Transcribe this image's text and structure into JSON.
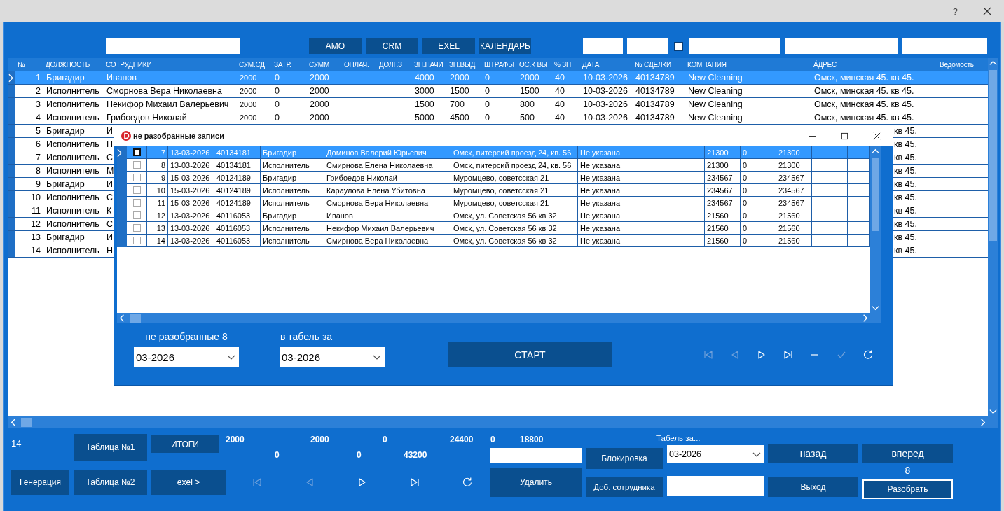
{
  "window": {
    "help": "?"
  },
  "toolbar": {
    "buttons": [
      "AMO",
      "CRM",
      "EXEL",
      "КАЛЕНДАРЬ"
    ],
    "filter_checkbox": {
      "checked": false
    }
  },
  "main_table": {
    "columns": [
      "№",
      "ДОЛЖНОСТЬ",
      "СОТРУДНИКИ",
      "СУМ.СД",
      "ЗАТР.",
      "СУММ",
      "ОПЛАЧ.",
      "ДОЛГ.З",
      "ЗП.НАЧИ",
      "ЗП.ВЫД.",
      "ШТРАФЫ",
      "ОС.К ВЫ",
      "% ЗП",
      "ДАТА",
      "№ СДЕЛКИ",
      "КОМПАНИЯ",
      "А́ДРЕС",
      "Ведомость"
    ],
    "rows": [
      {
        "kind": "full",
        "selected": true,
        "num": "1",
        "role": "Бригадир",
        "name": "Иванов",
        "sum_sd": "2000",
        "expenses": "0",
        "sum": "2000",
        "zp_accrued": "4000",
        "zp_paid": "2000",
        "fines": "0",
        "balance": "2000",
        "percent": "40",
        "date": "10-03-2026",
        "deal": "40134789",
        "company": "New Cleaning",
        "address": "Омск, минская 45. кв 45."
      },
      {
        "kind": "full",
        "selected": false,
        "num": "2",
        "role": "Исполнитель",
        "name": "Сморнова Вера Николаевна",
        "sum_sd": "2000",
        "expenses": "0",
        "sum": "2000",
        "zp_accrued": "3000",
        "zp_paid": "1500",
        "fines": "0",
        "balance": "1500",
        "percent": "40",
        "date": "10-03-2026",
        "deal": "40134789",
        "company": "New Cleaning",
        "address": "Омск, минская 45. кв 45."
      },
      {
        "kind": "full",
        "selected": false,
        "num": "3",
        "role": "Исполнитель",
        "name": "Некифор Михаил Валерьевич",
        "sum_sd": "2000",
        "expenses": "0",
        "sum": "2000",
        "zp_accrued": "1500",
        "zp_paid": "700",
        "fines": "0",
        "balance": "800",
        "percent": "40",
        "date": "10-03-2026",
        "deal": "40134789",
        "company": "New Cleaning",
        "address": "Омск, минская 45. кв 45."
      },
      {
        "kind": "full",
        "selected": false,
        "num": "4",
        "role": "Исполнитель",
        "name": "Грибоедов Николай",
        "sum_sd": "2000",
        "expenses": "0",
        "sum": "2000",
        "zp_accrued": "5000",
        "zp_paid": "4500",
        "fines": "0",
        "balance": "500",
        "percent": "40",
        "date": "10-03-2026",
        "deal": "40134789",
        "company": "New Cleaning",
        "address": "Омск, минская 45. кв 45."
      },
      {
        "kind": "partial",
        "selected": false,
        "num": "5",
        "role": "Бригадир",
        "name": "И",
        "address": "кв 45."
      },
      {
        "kind": "partial",
        "selected": false,
        "num": "6",
        "role": "Исполнитель",
        "name": "Н",
        "address": "кв 45."
      },
      {
        "kind": "partial",
        "selected": false,
        "num": "7",
        "role": "Исполнитель",
        "name": "С",
        "address": "кв 45."
      },
      {
        "kind": "partial",
        "selected": false,
        "num": "8",
        "role": "Исполнитель",
        "name": "М",
        "address": "кв 45."
      },
      {
        "kind": "partial",
        "selected": false,
        "num": "9",
        "role": "Бригадир",
        "name": "И",
        "address": "кв 45."
      },
      {
        "kind": "partial",
        "selected": false,
        "num": "10",
        "role": "Исполнитель",
        "name": "С",
        "address": "кв 45."
      },
      {
        "kind": "partial",
        "selected": false,
        "num": "11",
        "role": "Исполнитель",
        "name": "К",
        "address": "кв 45."
      },
      {
        "kind": "partial",
        "selected": false,
        "num": "12",
        "role": "Исполнитель",
        "name": "С",
        "address": "кв 45."
      },
      {
        "kind": "partial",
        "selected": false,
        "num": "13",
        "role": "Бригадир",
        "name": "И",
        "address": "кв 45."
      },
      {
        "kind": "partial",
        "selected": false,
        "num": "14",
        "role": "Исполнитель",
        "name": "Н",
        "address": "кв 45."
      }
    ]
  },
  "dialog": {
    "title": "не разобранные записи",
    "rows": [
      {
        "selected": true,
        "checked": false,
        "num": "7",
        "date": "13-03-2026",
        "deal": "40134181",
        "role": "Бригадир",
        "name": "Доминов Валерий Юрьевич",
        "address": "Омск, питерсий проезд 24, кв. 56",
        "company": "Не указана",
        "c1": "21300",
        "c2": "0",
        "c3": "21300"
      },
      {
        "selected": false,
        "checked": false,
        "num": "8",
        "date": "13-03-2026",
        "deal": "40134181",
        "role": "Исполнитель",
        "name": "Смирнова Елена Николаевна",
        "address": "Омск, питерсий проезд 24, кв. 56",
        "company": "Не указана",
        "c1": "21300",
        "c2": "0",
        "c3": "21300"
      },
      {
        "selected": false,
        "checked": false,
        "num": "9",
        "date": "15-03-2026",
        "deal": "40124189",
        "role": "Бригадир",
        "name": "Грибоедов Николай",
        "address": "Муромцево, советсская 21",
        "company": "Не указана",
        "c1": "234567",
        "c2": "0",
        "c3": "234567"
      },
      {
        "selected": false,
        "checked": false,
        "num": "10",
        "date": "15-03-2026",
        "deal": "40124189",
        "role": "Исполнитель",
        "name": "Караулова Елена Убитовна",
        "address": "Муромцево, советсская 21",
        "company": "Не указана",
        "c1": "234567",
        "c2": "0",
        "c3": "234567"
      },
      {
        "selected": false,
        "checked": false,
        "num": "11",
        "date": "15-03-2026",
        "deal": "40124189",
        "role": "Исполнитель",
        "name": "Сморнова Вера Николаевна",
        "address": "Муромцево, советсская 21",
        "company": "Не указана",
        "c1": "234567",
        "c2": "0",
        "c3": "234567"
      },
      {
        "selected": false,
        "checked": false,
        "num": "12",
        "date": "13-03-2026",
        "deal": "40116053",
        "role": "Бригадир",
        "name": "Иванов",
        "address": "Омск, ул. Советская 56 кв 32",
        "company": "Не указана",
        "c1": "21560",
        "c2": "0",
        "c3": "21560"
      },
      {
        "selected": false,
        "checked": false,
        "num": "13",
        "date": "13-03-2026",
        "deal": "40116053",
        "role": "Исполнитель",
        "name": "Некифор Михаил Валерьевич",
        "address": "Омск, ул. Советская 56 кв 32",
        "company": "Не указана",
        "c1": "21560",
        "c2": "0",
        "c3": "21560"
      },
      {
        "selected": false,
        "checked": false,
        "num": "14",
        "date": "13-03-2026",
        "deal": "40116053",
        "role": "Исполнитель",
        "name": "Смирнова Вера Николаевна",
        "address": "Омск, ул. Советская 56 кв 32",
        "company": "Не указана",
        "c1": "21560",
        "c2": "0",
        "c3": "21560"
      }
    ],
    "unsorted_label": "не разобранные 8",
    "unsorted_period": "03-2026",
    "target_label": "в табель за",
    "target_period": "03-2026",
    "start_button": "СТАРТ",
    "nav": [
      {
        "kind": "first",
        "disabled": true
      },
      {
        "kind": "prev",
        "disabled": true
      },
      {
        "kind": "next",
        "disabled": false
      },
      {
        "kind": "last",
        "disabled": false
      },
      {
        "kind": "minus",
        "disabled": false
      },
      {
        "kind": "check",
        "disabled": true
      },
      {
        "kind": "refresh",
        "disabled": false
      }
    ]
  },
  "footer": {
    "count": "14",
    "table1_button": "Таблица №1",
    "totals_button": "ИТОГИ",
    "generate_button": "Генерация",
    "table2_button": "Таблица №2",
    "excel_button": "exel >",
    "totals_row1": [
      "2000",
      "2000",
      "0",
      "24400"
    ],
    "totals_row2": [
      "0",
      "0",
      "43200"
    ],
    "totals_extra": [
      "0",
      "18800"
    ],
    "nav": [
      {
        "kind": "first",
        "disabled": true
      },
      {
        "kind": "prev",
        "disabled": true
      },
      {
        "kind": "next",
        "disabled": false
      },
      {
        "kind": "last",
        "disabled": false
      },
      {
        "kind": "refresh",
        "disabled": false
      }
    ],
    "delete_button": "Удалить",
    "lock_button": "Блокировка",
    "add_employee_button": "Доб. сотрудника",
    "period_label": "Табель за...",
    "period": "03-2026",
    "back_button": "назад",
    "forward_button": "вперед",
    "pending_count": "8",
    "exit_button": "Выход",
    "sort_button": "Разобрать"
  }
}
